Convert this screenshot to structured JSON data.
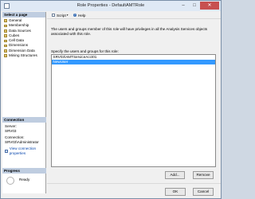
{
  "window": {
    "title": "Role Properties - DefaultAMTRole",
    "minimize_glyph": "–",
    "maximize_glyph": "□",
    "close_glyph": "✕"
  },
  "left_pane": {
    "header": "Select a page",
    "pages": [
      "General",
      "Membership",
      "Data Sources",
      "Cubes",
      "Cell Data",
      "Dimensions",
      "Dimension Data",
      "Mining Structures"
    ],
    "connection": {
      "header": "Connection",
      "server_label": "Server:",
      "server_value": "SRV03",
      "connection_label": "Connection:",
      "connection_value": "SRV03\\Administrator",
      "view_link": "View connection properties"
    },
    "progress": {
      "header": "Progress",
      "status": "Ready"
    }
  },
  "toolbar": {
    "script_label": "Script",
    "help_label": "Help"
  },
  "main": {
    "description": "The users and groups member of this role will have privileges in all the Analysis Services objects associated with this role.",
    "members_label": "Specify the users and groups for this role:",
    "members": [
      {
        "name": "SRV03\\AMTServiceAcct01",
        "selected": false
      },
      {
        "name": "NewUser",
        "selected": true
      }
    ],
    "add_button": "Add...",
    "remove_button": "Remove"
  },
  "footer": {
    "ok_button": "OK",
    "cancel_button": "Cancel"
  },
  "colors": {
    "selection": "#3399ff",
    "header_band": "#bfcde0",
    "link": "#0645ad"
  }
}
